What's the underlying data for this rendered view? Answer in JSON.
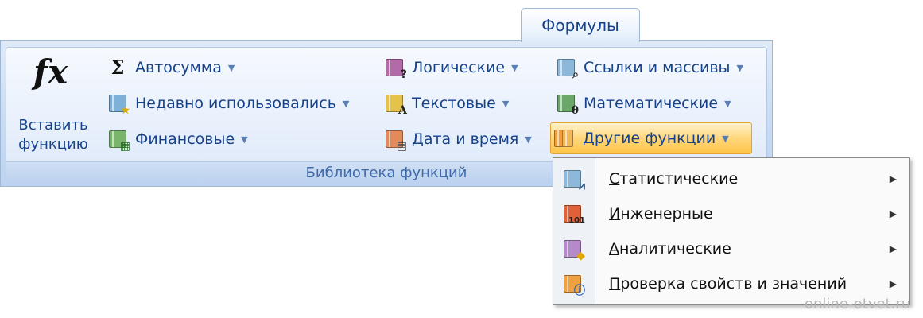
{
  "tab": {
    "label": "Формулы"
  },
  "insert_function": {
    "line1": "Вставить",
    "line2": "функцию"
  },
  "group": {
    "label": "Библиотека функций"
  },
  "commands": {
    "autosum": "Автосумма",
    "recent": "Недавно использовались",
    "financial": "Финансовые",
    "logical": "Логические",
    "text": "Текстовые",
    "datetime": "Дата и время",
    "lookup": "Ссылки и массивы",
    "math": "Математические",
    "more": "Другие функции"
  },
  "menu": {
    "items": [
      {
        "first": "С",
        "rest": "татистические"
      },
      {
        "first": "И",
        "rest": "нженерные"
      },
      {
        "first": "А",
        "rest": "налитические"
      },
      {
        "first": "П",
        "rest": "роверка свойств и значений"
      }
    ]
  },
  "icons": {
    "autosum": "sigma-icon",
    "recent": "recent-star-icon",
    "financial": "financial-icon",
    "logical": "logical-question-icon",
    "text": "text-a-icon",
    "datetime": "calendar-icon",
    "lookup": "magnifier-icon",
    "math": "theta-icon",
    "more": "books-icon"
  },
  "colors": {
    "accent": "#15428b",
    "active_bg": "#ffd67a"
  },
  "watermark": "online-otvet.ru"
}
